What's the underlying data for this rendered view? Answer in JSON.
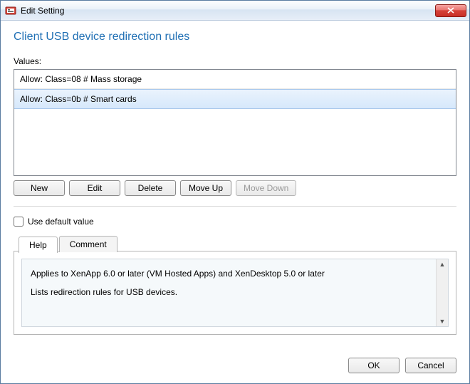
{
  "window": {
    "title": "Edit Setting"
  },
  "page": {
    "title": "Client USB device redirection rules",
    "values_label": "Values:"
  },
  "rules": [
    {
      "text": "Allow: Class=08 # Mass storage",
      "selected": false
    },
    {
      "text": "Allow: Class=0b # Smart cards",
      "selected": true
    }
  ],
  "buttons": {
    "new": "New",
    "edit": "Edit",
    "delete": "Delete",
    "move_up": "Move Up",
    "move_down": "Move Down",
    "move_down_disabled": true
  },
  "use_default": {
    "label": "Use default value",
    "checked": false
  },
  "tabs": {
    "help": "Help",
    "comment": "Comment",
    "active": "help"
  },
  "help_text": {
    "line1": "Applies to XenApp 6.0 or later (VM Hosted Apps) and XenDesktop 5.0 or later",
    "line2": "Lists redirection rules for USB devices."
  },
  "footer": {
    "ok": "OK",
    "cancel": "Cancel"
  }
}
